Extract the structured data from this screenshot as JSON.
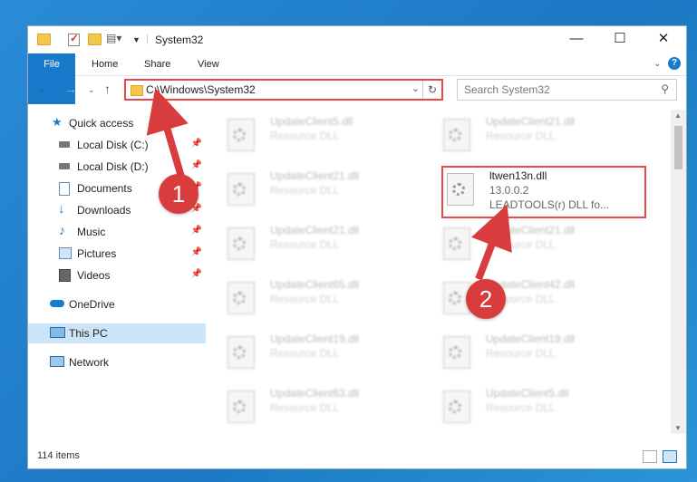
{
  "window": {
    "title": "System32",
    "controls": {
      "minimize": "—",
      "maximize": "☐",
      "close": "✕"
    }
  },
  "ribbon": {
    "tabs": [
      "File",
      "Home",
      "Share",
      "View"
    ],
    "help": "?"
  },
  "address": {
    "path": "C:\\Windows\\System32",
    "search_placeholder": "Search System32"
  },
  "nav_pane": {
    "quick_access": "Quick access",
    "items": [
      {
        "label": "Local Disk (C:)",
        "icon": "drive-icon",
        "pinned": true
      },
      {
        "label": "Local Disk (D:)",
        "icon": "drive-icon",
        "pinned": true
      },
      {
        "label": "Documents",
        "icon": "documents-icon",
        "pinned": true
      },
      {
        "label": "Downloads",
        "icon": "download-icon",
        "pinned": true
      },
      {
        "label": "Music",
        "icon": "music-icon",
        "pinned": true
      },
      {
        "label": "Pictures",
        "icon": "pictures-icon",
        "pinned": true
      },
      {
        "label": "Videos",
        "icon": "videos-icon",
        "pinned": true
      }
    ],
    "onedrive": "OneDrive",
    "this_pc": "This PC",
    "network": "Network"
  },
  "files": [
    {
      "name": "UpdateClient5.dll",
      "desc": "Resource DLL"
    },
    {
      "name": "UpdateClient21.dll",
      "desc": "Resource DLL"
    },
    {
      "name": "UpdateClient21.dll",
      "desc": "Resource DLL"
    },
    {
      "name": "ltwen13n.dll",
      "version": "13.0.0.2",
      "desc": "LEADTOOLS(r) DLL fo..."
    },
    {
      "name": "UpdateClient21.dll",
      "desc": "Resource DLL"
    },
    {
      "name": "UpdateClient21.dll",
      "desc": "Resource DLL"
    },
    {
      "name": "UpdateClient65.dll",
      "desc": "Resource DLL"
    },
    {
      "name": "UpdateClient42.dll",
      "desc": "Resource DLL"
    },
    {
      "name": "UpdateClient19.dll",
      "desc": "Resource DLL"
    },
    {
      "name": "UpdateClient19.dll",
      "desc": "Resource DLL"
    },
    {
      "name": "UpdateClient63.dll",
      "desc": "Resource DLL"
    },
    {
      "name": "UpdateClient5.dll",
      "desc": "Resource DLL"
    }
  ],
  "status": {
    "item_count": "114 items"
  },
  "callouts": [
    "1",
    "2"
  ],
  "colors": {
    "accent": "#1979ca",
    "highlight": "#e8474b",
    "callout": "#d93c3c",
    "selected": "#cce4f7"
  }
}
